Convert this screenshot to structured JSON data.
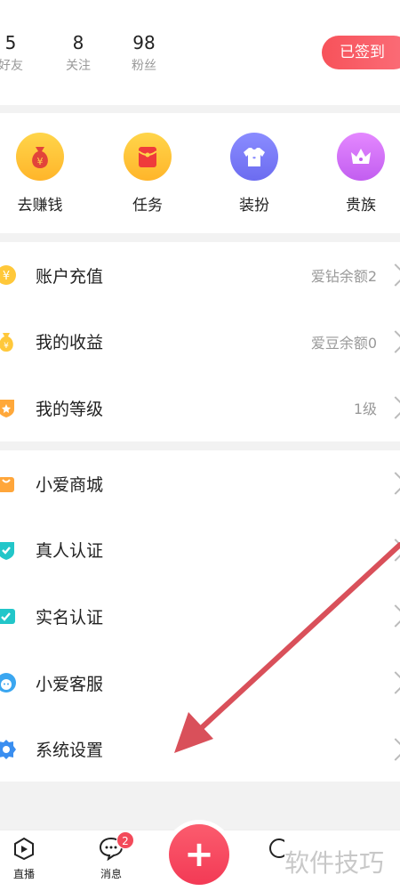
{
  "stats": [
    {
      "value": "5",
      "label": "好友"
    },
    {
      "value": "8",
      "label": "关注"
    },
    {
      "value": "98",
      "label": "粉丝"
    }
  ],
  "checkin_label": "已签到",
  "quick_actions": [
    {
      "label": "去赚钱",
      "icon": "money-bag-icon"
    },
    {
      "label": "任务",
      "icon": "red-envelope-icon"
    },
    {
      "label": "装扮",
      "icon": "tshirt-icon"
    },
    {
      "label": "贵族",
      "icon": "crown-icon"
    }
  ],
  "wallet_group": [
    {
      "label": "账户充值",
      "value": "爱钻余额2"
    },
    {
      "label": "我的收益",
      "value": "爱豆余额0"
    },
    {
      "label": "我的等级",
      "value": "1级"
    }
  ],
  "service_group": [
    {
      "label": "小爱商城"
    },
    {
      "label": "真人认证"
    },
    {
      "label": "实名认证"
    },
    {
      "label": "小爱客服"
    },
    {
      "label": "系统设置"
    }
  ],
  "tabbar": {
    "live_label": "直播",
    "messages_label": "消息",
    "messages_badge": "2",
    "plus_symbol": "+"
  },
  "watermark": "软件技巧",
  "colors": {
    "accent": "#f4485c",
    "arrow": "#d9505a"
  }
}
